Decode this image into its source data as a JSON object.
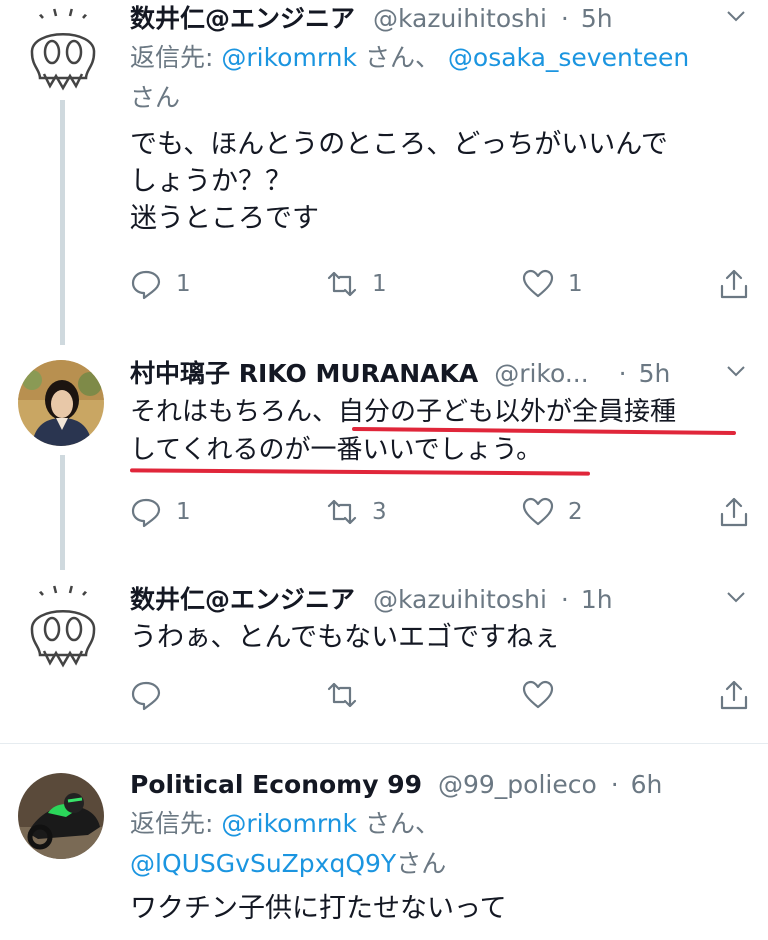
{
  "tweets": [
    {
      "name": "数井仁@エンジニア",
      "handle": "@kazuihitoshi",
      "sep": "·",
      "time": "5h",
      "reply_prefix": "返信先: ",
      "reply_link1": "@rikomrnk",
      "reply_mid": " さん、 ",
      "reply_link2": "@osaka_seventeen",
      "reply_suffix": "さん",
      "text_line1": "でも、ほんとうのところ、どっちがいいんで",
      "text_line2": "しょうか？？",
      "text_line3": "迷うところです",
      "reply_count": "1",
      "retweet_count": "1",
      "like_count": "1"
    },
    {
      "name": "村中璃子 RIKO MURANAKA",
      "handle": "@riko...",
      "sep": "·",
      "time": "5h",
      "text_line1": "それはもちろん、自分の子ども以外が全員接種",
      "text_line2": "してくれるのが一番いいでしょう。",
      "reply_count": "1",
      "retweet_count": "3",
      "like_count": "2"
    },
    {
      "name": "数井仁@エンジニア",
      "handle": "@kazuihitoshi",
      "sep": "·",
      "time": "1h",
      "text_line1": "うわぁ、とんでもないエゴですねぇ",
      "reply_count": "",
      "retweet_count": "",
      "like_count": ""
    },
    {
      "name": "Political Economy 99",
      "handle": "@99_polieco",
      "sep": "·",
      "time": "6h",
      "reply_prefix": "返信先: ",
      "reply_link1": "@rikomrnk",
      "reply_mid": " さん、",
      "reply_link2": "@lQUSGvSuZpxqQ9Y",
      "reply_suffix": "さん",
      "text_line1": "ワクチン子供に打たせないって"
    }
  ],
  "icons": {
    "reply": "reply-icon",
    "retweet": "retweet-icon",
    "like": "heart-icon",
    "share": "share-icon",
    "more": "chevron-down-icon"
  },
  "colors": {
    "link": "#1b95e0",
    "muted": "#6b7883",
    "text": "#141823",
    "underline": "#e0263a"
  }
}
